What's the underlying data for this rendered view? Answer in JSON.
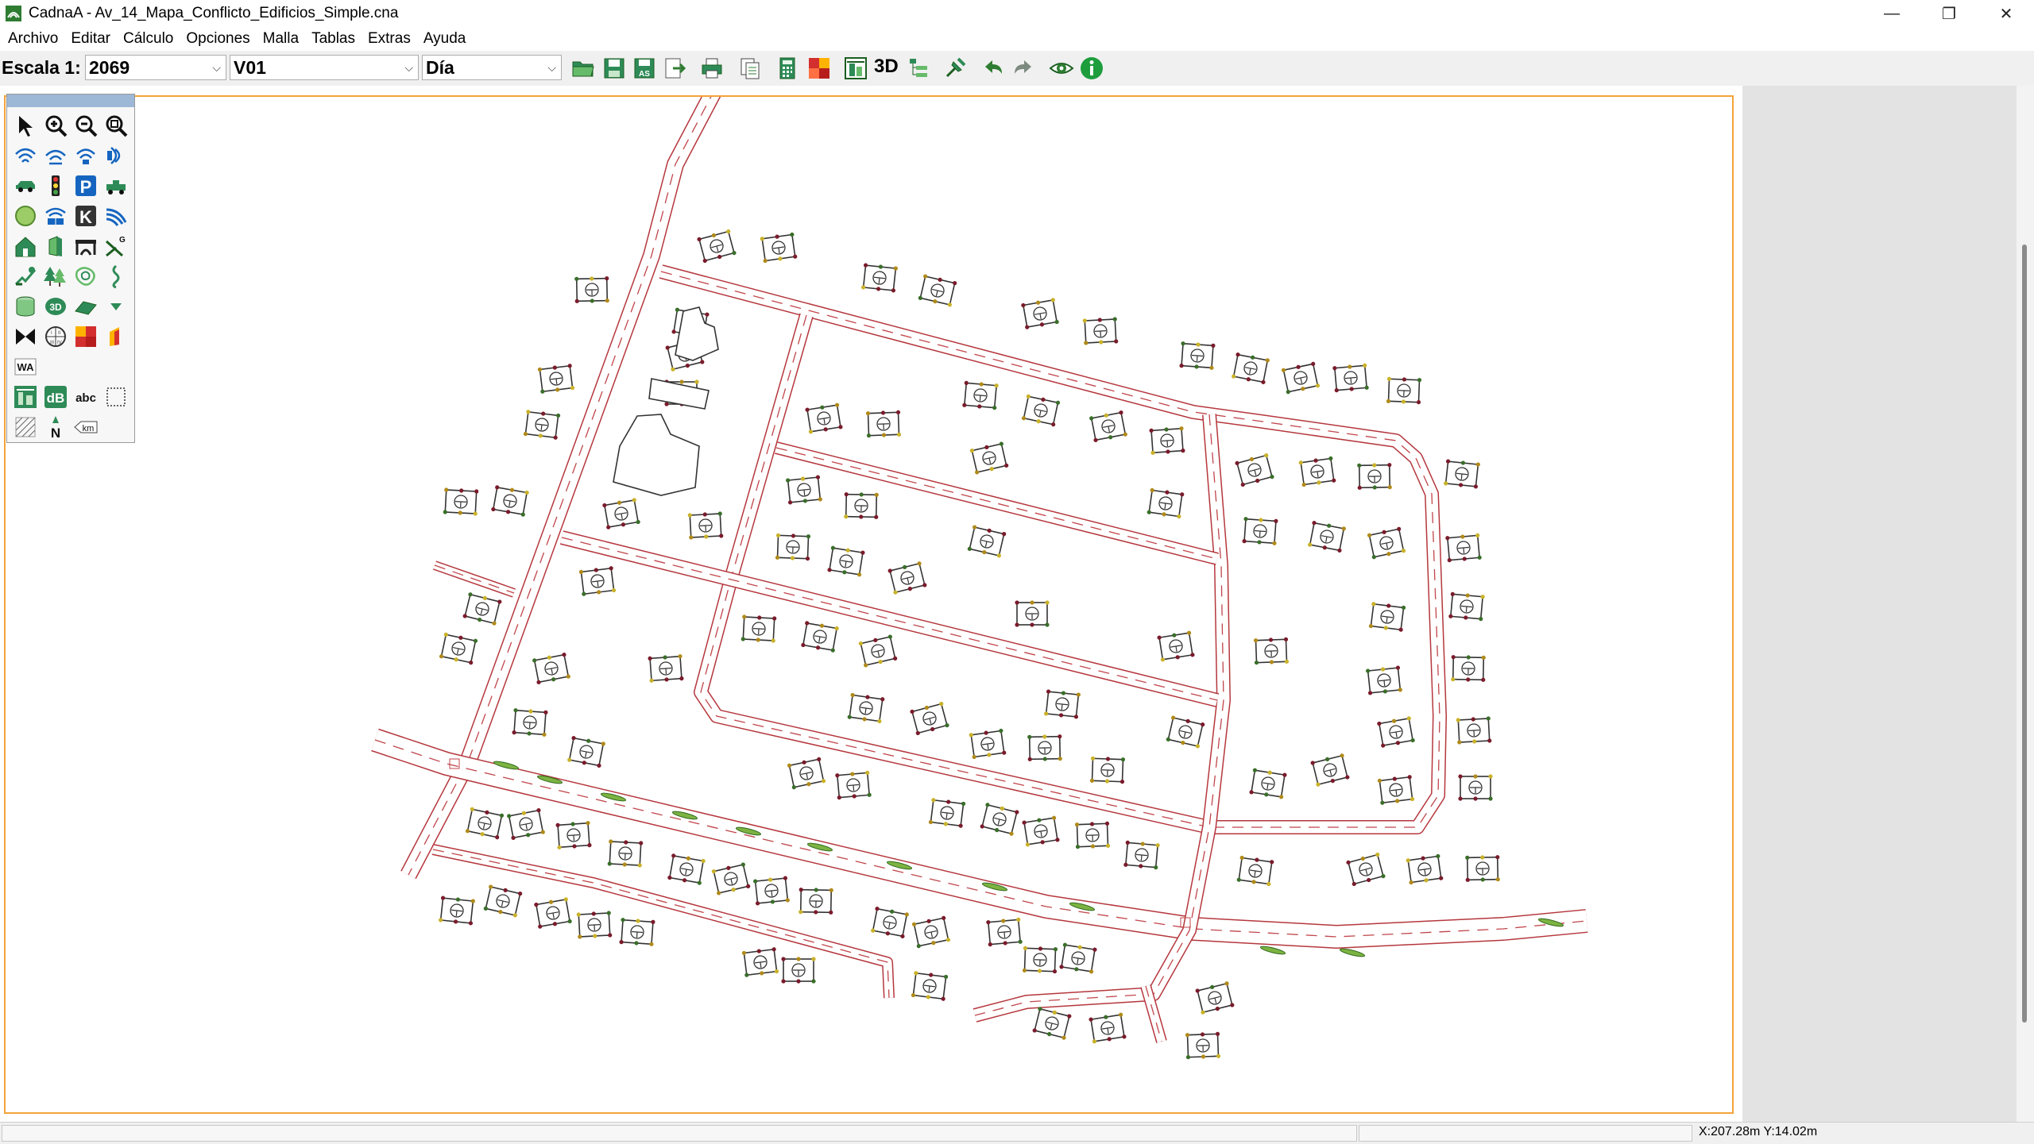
{
  "window": {
    "title": "CadnaA - Av_14_Mapa_Conflicto_Edificios_Simple.cna",
    "minimize": "—",
    "maximize": "❐",
    "close": "✕"
  },
  "menu": [
    "Archivo",
    "Editar",
    "Cálculo",
    "Opciones",
    "Malla",
    "Tablas",
    "Extras",
    "Ayuda"
  ],
  "toolbar": {
    "scale_label": "Escala 1:",
    "scale_value": "2069",
    "variant_value": "V01",
    "period_value": "Día",
    "dropdown_arrow": "⌵",
    "three_d_label": "3D",
    "accent_green": "#1a9a3a",
    "accent_blue": "#1565c0",
    "accent_red": "#d32f2f"
  },
  "palette": {
    "rows": [
      [
        "pointer-tool-icon",
        "zoom-in-icon",
        "zoom-out-icon",
        "zoom-extent-icon"
      ],
      [
        "point-source-icon",
        "line-source-icon",
        "area-source-icon",
        "vertical-source-icon"
      ],
      [
        "road-icon",
        "traffic-light-icon",
        "parking-lot-icon",
        "railway-icon"
      ],
      [
        "industry-icon",
        "tennis-court-icon",
        "k-text-icon",
        "wind-icon"
      ],
      [
        "building-icon",
        "barrier-icon",
        "bridge-icon",
        "ground-absorption-icon"
      ],
      [
        "receiver-icon",
        "forest-icon",
        "contour-icon",
        "height-line-icon"
      ],
      [
        "cylinder-icon",
        "3d-reflector-icon",
        "terrain-icon",
        "triangle-down-icon"
      ],
      [
        "bow-tie-icon",
        "settings-table-icon",
        "grid-color-icon",
        "partial-grid-icon"
      ],
      [
        "wa-icon"
      ],
      [
        "noise-map-icon",
        "db-label-icon",
        "text-abc-icon",
        "auxiliary-polygon-icon"
      ],
      [
        "hatch-icon",
        "north-arrow-icon",
        "km-scale-icon"
      ]
    ],
    "wa_text": "WA",
    "db_text": "dB",
    "abc_text": "abc",
    "k_text": "K",
    "p_text": "P",
    "north_text": "N",
    "km_text": "km",
    "three_d_text": "3D"
  },
  "status": {
    "coordinates": "X:207.28m Y:14.02m"
  }
}
